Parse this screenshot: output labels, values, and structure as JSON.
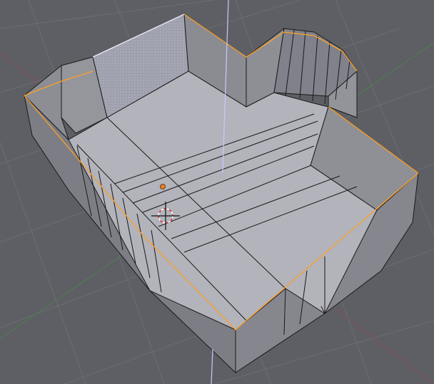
{
  "viewport": {
    "view": "user-perspective",
    "background_color": "#5d5f64",
    "grid_color": "#6b6d72",
    "x_axis_color": "#8a4f55",
    "y_axis_color": "#4f7f4f",
    "z_axis_color": "#c8c8ff",
    "selection_edge_color": "#ffa024",
    "mesh_wire_color": "#1a1a1a"
  },
  "scene": {
    "object": "room-mesh",
    "mode": "edit-mode",
    "select_mode": "edge",
    "origin_icon": "object-origin-dot",
    "cursor_icon": "3d-cursor-crosshair",
    "floor_color": "#b2b3bb",
    "wall_inner_color": "#8e8f95",
    "wall_outer_color": "#7a7b81"
  }
}
